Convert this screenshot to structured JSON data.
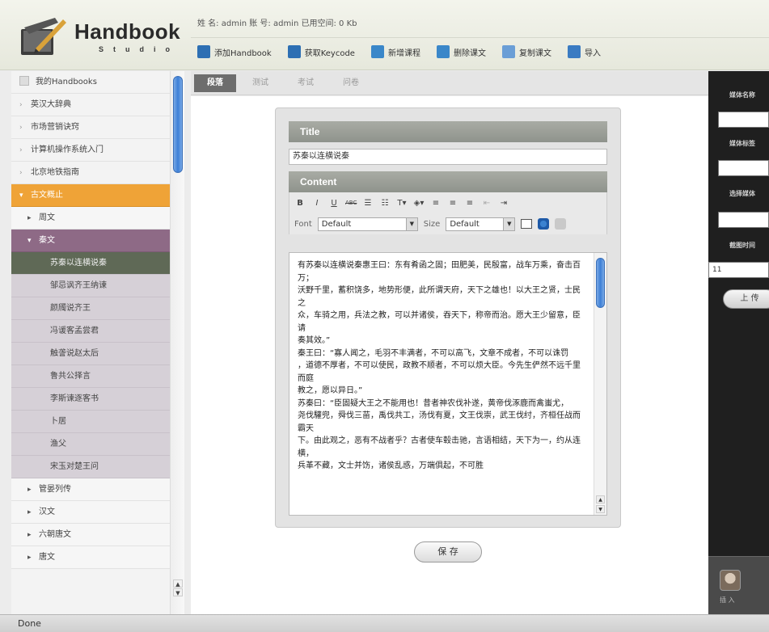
{
  "app": {
    "logo_word": "Handbook",
    "logo_sub": "Studio",
    "user_info": "姓 名: admin 账 号: admin 已用空间: 0 Kb"
  },
  "toolbar": [
    {
      "label": "添加Handbook",
      "icon": "book-add-icon",
      "color": "#2d6fb3"
    },
    {
      "label": "获取Keycode",
      "icon": "key-book-icon",
      "color": "#2d6fb3"
    },
    {
      "label": "新增课程",
      "icon": "page-add-icon",
      "color": "#3a87c9"
    },
    {
      "label": "删除课文",
      "icon": "page-delete-icon",
      "color": "#3a87c9"
    },
    {
      "label": "复制课文",
      "icon": "page-copy-icon",
      "color": "#6a9ed6"
    },
    {
      "label": "导入",
      "icon": "import-icon",
      "color": "#3a7bc2"
    }
  ],
  "sidebar": {
    "items": [
      {
        "label": "我的Handbooks",
        "type": "first"
      },
      {
        "label": "英汉大辞典",
        "type": "top"
      },
      {
        "label": "市场营销诀窍",
        "type": "top"
      },
      {
        "label": "计算机操作系统入门",
        "type": "top"
      },
      {
        "label": "北京地铁指南",
        "type": "top"
      },
      {
        "label": "古文概止",
        "type": "active"
      },
      {
        "label": "周文",
        "type": "sub"
      },
      {
        "label": "秦文",
        "type": "sub-open"
      },
      {
        "label": "苏秦以连横说秦",
        "type": "leaf-selected"
      },
      {
        "label": "邹忌讽齐王纳谏",
        "type": "leaf"
      },
      {
        "label": "颜斶说齐王",
        "type": "leaf"
      },
      {
        "label": "冯谖客孟尝君",
        "type": "leaf"
      },
      {
        "label": "触詟说赵太后",
        "type": "leaf"
      },
      {
        "label": "鲁共公择言",
        "type": "leaf"
      },
      {
        "label": "李斯谏逐客书",
        "type": "leaf"
      },
      {
        "label": "卜居",
        "type": "leaf"
      },
      {
        "label": "渔父",
        "type": "leaf"
      },
      {
        "label": "宋玉对楚王问",
        "type": "leaf"
      },
      {
        "label": "管晏列传",
        "type": "sub"
      },
      {
        "label": "汉文",
        "type": "sub"
      },
      {
        "label": "六朝唐文",
        "type": "sub"
      },
      {
        "label": "唐文",
        "type": "sub"
      }
    ]
  },
  "tabs": [
    {
      "label": "段落",
      "active": true
    },
    {
      "label": "测试",
      "active": false
    },
    {
      "label": "考试",
      "active": false
    },
    {
      "label": "问卷",
      "active": false
    }
  ],
  "editor": {
    "title_section": "Title",
    "title_value": "苏秦以连横说秦",
    "content_section": "Content",
    "font_label": "Font",
    "font_value": "Default",
    "size_label": "Size",
    "size_value": "Default",
    "content_text": "有苏秦以连横说秦惠王曰：东有肴函之固；田肥美，民殷富，战车万乘，奋击百万；\n沃野千里，蓄积饶多，地势形便，此所谓天府，天下之雄也！以大王之贤，士民之\n众，车骑之用，兵法之教，可以并诸侯，吞天下，称帝而治。愿大王少留意，臣请\n奏其效。”\n秦王曰：“寡人闻之，毛羽不丰满者，不可以高飞，文章不成者，不可以诛罚\n，道德不厚者，不可以使民，政教不顺者，不可以烦大臣。今先生俨然不远千里而庭\n教之，愿以异日。”\n苏秦曰：“臣固疑大王之不能用也！昔者神农伐补遂，黄帝伐涿鹿而禽蚩尤，\n尧伐驩兜，舜伐三苗，禹伐共工，汤伐有夏，文王伐崇，武王伐纣，齐桓任战而霸天\n下。由此观之，恶有不战者乎？古者使车毂击驰，言语相结，天下为一，约从连横，\n兵革不藏，文士并饬，诸侯乱惑，万端俱起，不可胜"
  },
  "save_label": "保 存",
  "right_panel": {
    "labels": [
      "媒体名称",
      "媒体标签",
      "选择媒体",
      "截图时间"
    ],
    "time_value": "11",
    "upload_label": "上 传",
    "bottom_caption": "插 入"
  },
  "status_text": "Done"
}
